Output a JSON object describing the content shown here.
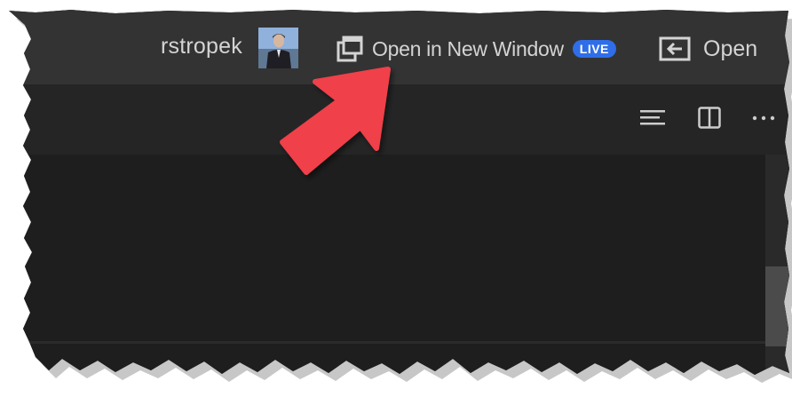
{
  "header": {
    "username": "rstropek",
    "open_new_window_label": "Open in New Window",
    "live_badge": "LIVE",
    "open_label": "Open"
  },
  "toolbar": {
    "icons": [
      "format-lines-icon",
      "split-editor-icon",
      "more-actions-icon"
    ],
    "more_glyph": "···"
  },
  "colors": {
    "topbar_bg": "#333333",
    "toolbar_bg": "#252526",
    "editor_bg": "#1e1e1e",
    "live_badge_bg": "#2f6ee8",
    "annotation_arrow": "#f0404a",
    "text": "#d4d4d4"
  }
}
